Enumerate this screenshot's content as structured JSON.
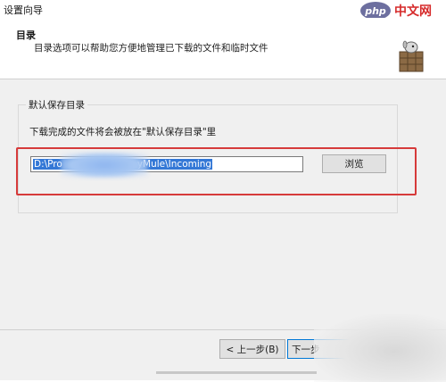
{
  "window": {
    "title": "设置向导"
  },
  "watermark": {
    "logo_text": "php",
    "site_text": "中文网"
  },
  "header": {
    "title": "目录",
    "description": "目录选项可以帮助您方便地管理已下载的文件和临时文件",
    "icon": "mule-icon"
  },
  "group": {
    "legend": "默认保存目录",
    "description": "下载完成的文件将会被放在\"默认保存目录\"里",
    "path_prefix": "D:\\Pro",
    "path_suffix": "yMule\\Incoming",
    "browse_label": "浏览"
  },
  "footer": {
    "prev_label": "< 上一步(B)",
    "next_label": "下一步"
  },
  "colors": {
    "highlight_box": "#d63a3a",
    "selection": "#3478d6",
    "accent": "#0078d7"
  }
}
